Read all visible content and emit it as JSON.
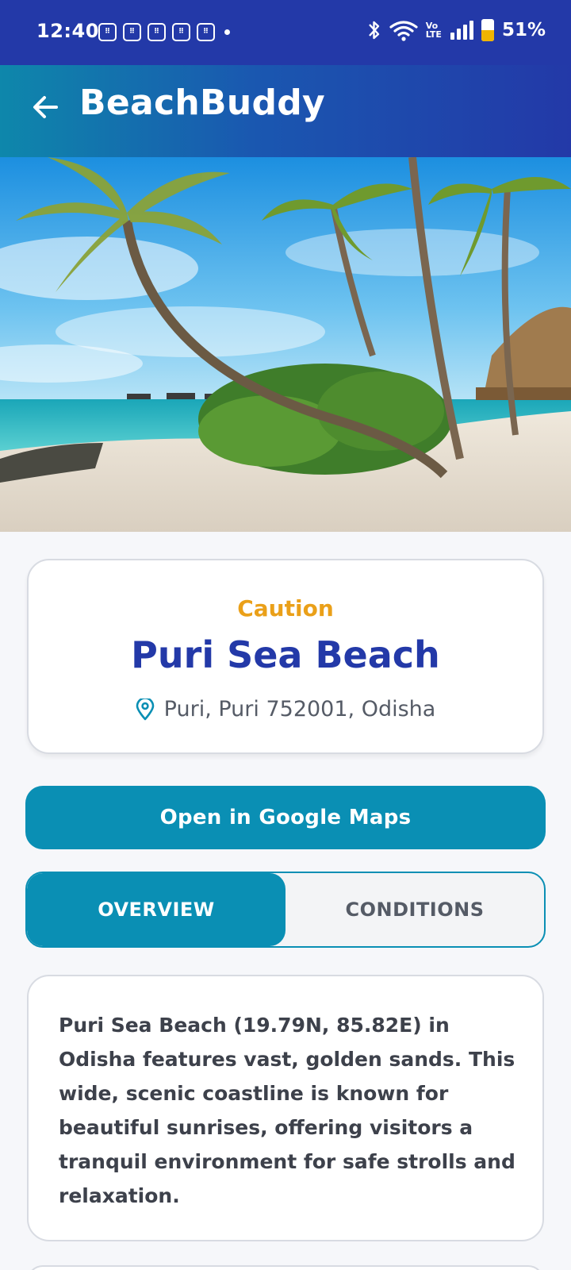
{
  "status_bar": {
    "time": "12:40",
    "battery_percent": "51%",
    "battery_level": 0.51,
    "notification_icon_count": 5,
    "icons": [
      "notification-icon",
      "bluetooth-icon",
      "wifi-icon",
      "volte-icon",
      "signal-icon",
      "battery-icon"
    ],
    "volte_label_top": "Vo",
    "volte_label_bottom": "LTE"
  },
  "app_bar": {
    "title": "BeachBuddy",
    "back_icon": "arrow-left-icon"
  },
  "beach": {
    "status": "Caution",
    "name": "Puri Sea Beach",
    "location": "Puri, Puri 752001, Odisha",
    "location_icon": "map-pin-icon"
  },
  "actions": {
    "maps_button": "Open in Google Maps"
  },
  "tabs": [
    {
      "label": "OVERVIEW",
      "active": true
    },
    {
      "label": "CONDITIONS",
      "active": false
    }
  ],
  "overview": {
    "text": "Puri Sea Beach (19.79N, 85.82E) in Odisha features vast, golden sands. This wide, scenic coastline is known for beautiful sunrises, offering visitors a tranquil environment for safe strolls and relaxation."
  },
  "colors": {
    "primary": "#2339a8",
    "accent": "#0a8fb4",
    "caution": "#eaa019",
    "text": "#3d414b"
  }
}
